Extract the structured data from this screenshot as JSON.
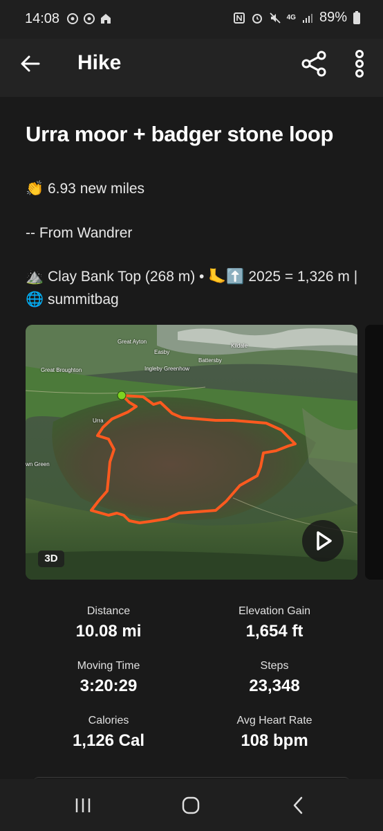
{
  "status_bar": {
    "time": "14:08",
    "battery": "89%",
    "network": "4G",
    "left_icons": [
      "chrome-icon",
      "chrome-icon",
      "home-app-icon"
    ],
    "right_icons": [
      "nfc-icon",
      "alarm-icon",
      "mute-icon",
      "network-4g-icon",
      "signal-icon",
      "battery-icon"
    ]
  },
  "app_bar": {
    "title": "Hike",
    "back_icon": "arrow-left-icon",
    "share_icon": "share-icon",
    "more_icon": "more-vertical-icon"
  },
  "activity": {
    "title": "Urra moor + badger stone loop",
    "description": {
      "line1": "👏 6.93 new miles",
      "line2": "-- From Wandrer",
      "line3": "⛰️ Clay Bank Top (268 m) • 🦶⬆️ 2025 = 1,326 m | 🌐 summitbag"
    }
  },
  "map": {
    "labels": {
      "great_ayton": "Great Ayton",
      "easby": "Easby",
      "kildale": "Kildale",
      "battersby": "Battersby",
      "great_broughton": "Great Broughton",
      "ingleby_greenhow": "Ingleby Greenhow",
      "urra": "Urra",
      "own_green": "wn Green"
    },
    "badge_3d": "3D",
    "play_icon": "play-icon",
    "route_color": "#ff5a1f",
    "start_color": "#7ed321"
  },
  "stats": [
    {
      "label": "Distance",
      "value": "10.08 mi"
    },
    {
      "label": "Elevation Gain",
      "value": "1,654 ft"
    },
    {
      "label": "Moving Time",
      "value": "3:20:29"
    },
    {
      "label": "Steps",
      "value": "23,348"
    },
    {
      "label": "Calories",
      "value": "1,126 Cal"
    },
    {
      "label": "Avg Heart Rate",
      "value": "108 bpm"
    }
  ],
  "nav_bar": {
    "recents_icon": "recents-icon",
    "home_icon": "home-icon",
    "back_icon": "back-icon"
  }
}
